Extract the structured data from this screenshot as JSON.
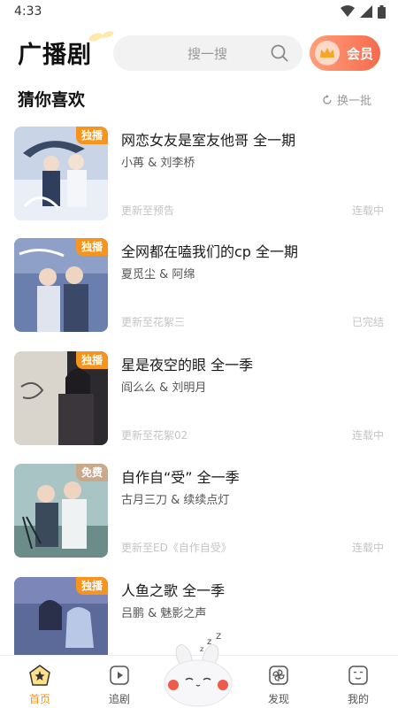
{
  "status": {
    "time": "4:33"
  },
  "header": {
    "brand": "广播剧",
    "search_placeholder": "搜一搜",
    "vip_label": "会员"
  },
  "section": {
    "title": "猜你喜欢",
    "refresh_label": "换一批"
  },
  "items": [
    {
      "title": "网恋女友是室友他哥 全一期",
      "cast": "小苒 & 刘李桥",
      "update": "更新至预告",
      "status": "连载中",
      "badge": "独播",
      "badge_type": "exclusive"
    },
    {
      "title": "全网都在嗑我们的cp 全一期",
      "cast": "夏觅尘 & 阿绵",
      "update": "更新至花絮三",
      "status": "已完结",
      "badge": "独播",
      "badge_type": "exclusive"
    },
    {
      "title": "星是夜空的眼 全一季",
      "cast": "阎么么 & 刘明月",
      "update": "更新至花絮02",
      "status": "连载中",
      "badge": "独播",
      "badge_type": "exclusive"
    },
    {
      "title": "自作自“受” 全一季",
      "cast": "古月三刀 & 续续点灯",
      "update": "更新至ED《自作自受》",
      "status": "连载中",
      "badge": "免费",
      "badge_type": "free"
    },
    {
      "title": "人鱼之歌 全一季",
      "cast": "吕鹏 & 魅影之声",
      "update": "",
      "status": "",
      "badge": "独播",
      "badge_type": "exclusive"
    }
  ],
  "tabs": [
    {
      "label": "首页",
      "icon": "home-star-icon",
      "active": true
    },
    {
      "label": "追剧",
      "icon": "play-icon",
      "active": false
    },
    {
      "label": "发现",
      "icon": "pinwheel-icon",
      "active": false
    },
    {
      "label": "我的",
      "icon": "face-icon",
      "active": false
    }
  ],
  "colors": {
    "accent": "#f7941d",
    "vip_start": "#ffa07a",
    "vip_end": "#f56b4e",
    "muted": "#c4c4c4"
  }
}
